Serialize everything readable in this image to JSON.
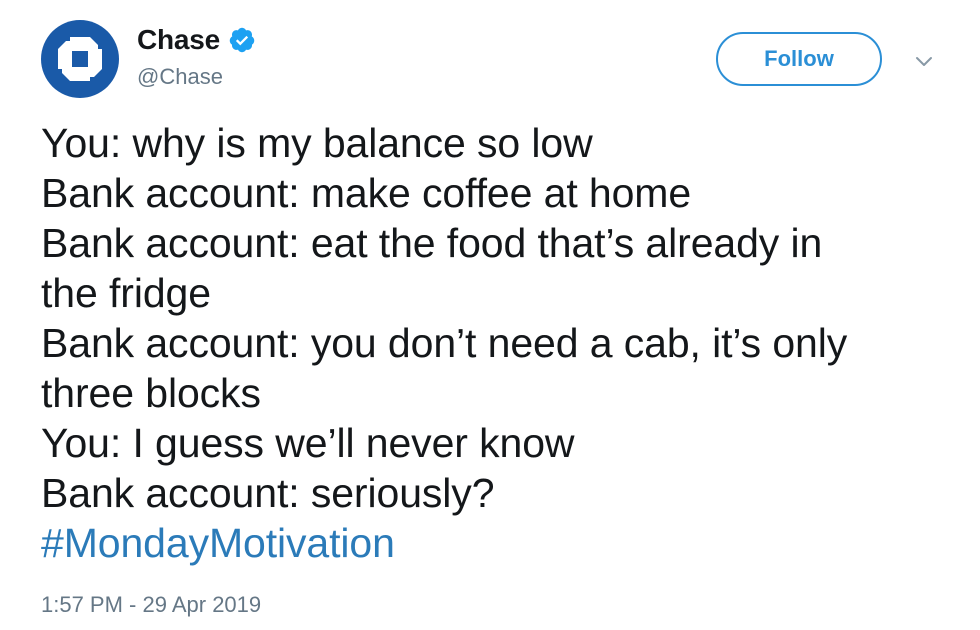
{
  "user": {
    "display_name": "Chase",
    "handle": "@Chase",
    "verified": true,
    "avatar_icon": "chase-octagon-logo-icon",
    "brand_color": "#1a5aa8"
  },
  "actions": {
    "follow_label": "Follow",
    "menu_icon": "chevron-down-icon",
    "accent_color": "#2b8fd6"
  },
  "tweet": {
    "lines": [
      "You: why is my balance so low",
      "Bank account: make coffee at home",
      "Bank account: eat the food that’s already in",
      "the fridge",
      "Bank account: you don’t need a cab, it’s only",
      "three blocks",
      "You: I guess we’ll never know",
      "Bank account: seriously?"
    ],
    "hashtag": "#MondayMotivation",
    "hashtag_color": "#2b7bb9"
  },
  "meta": {
    "timestamp": "1:57 PM - 29 Apr 2019"
  }
}
